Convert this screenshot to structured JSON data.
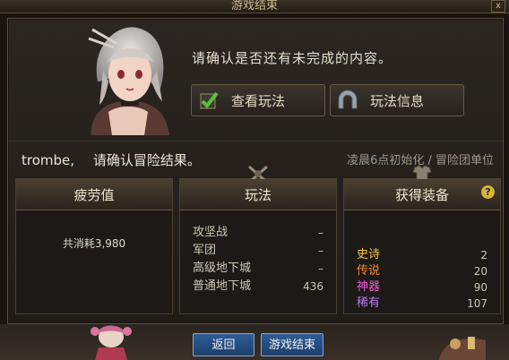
{
  "window": {
    "title": "游戏结束",
    "close_label": "x"
  },
  "npc": {
    "prompt": "请确认是否还有未完成的内容。"
  },
  "actions": {
    "view_label": "查看玩法",
    "info_label": "玩法信息"
  },
  "player": {
    "name": "trombe,",
    "confirm_text": "请确认冒险结果。",
    "reset_note": "凌晨6点初始化 / 冒险团单位"
  },
  "fatigue": {
    "title": "疲劳值",
    "total_text": "共消耗3,980"
  },
  "gameplay": {
    "title": "玩法",
    "rows": [
      {
        "label": "攻坚战",
        "value": "–"
      },
      {
        "label": "军团",
        "value": "–"
      },
      {
        "label": "高级地下城",
        "value": "–"
      },
      {
        "label": "普通地下城",
        "value": "436"
      }
    ]
  },
  "equipment": {
    "title": "获得装备",
    "help": "?",
    "rows": [
      {
        "label": "史诗",
        "value": "2",
        "color": "#f2c744"
      },
      {
        "label": "传说",
        "value": "20",
        "color": "#f08a2a"
      },
      {
        "label": "神器",
        "value": "90",
        "color": "#f15bd0"
      },
      {
        "label": "稀有",
        "value": "107",
        "color": "#b77cf0"
      }
    ]
  },
  "footer": {
    "back_label": "返回",
    "end_label": "游戏结束"
  },
  "colors": {
    "accent_gold": "#cbb98f",
    "button_blue": "#2f5d93"
  },
  "icons": [
    "check-icon",
    "shield-arch-icon",
    "question-icon",
    "crossed-swords-icon"
  ]
}
